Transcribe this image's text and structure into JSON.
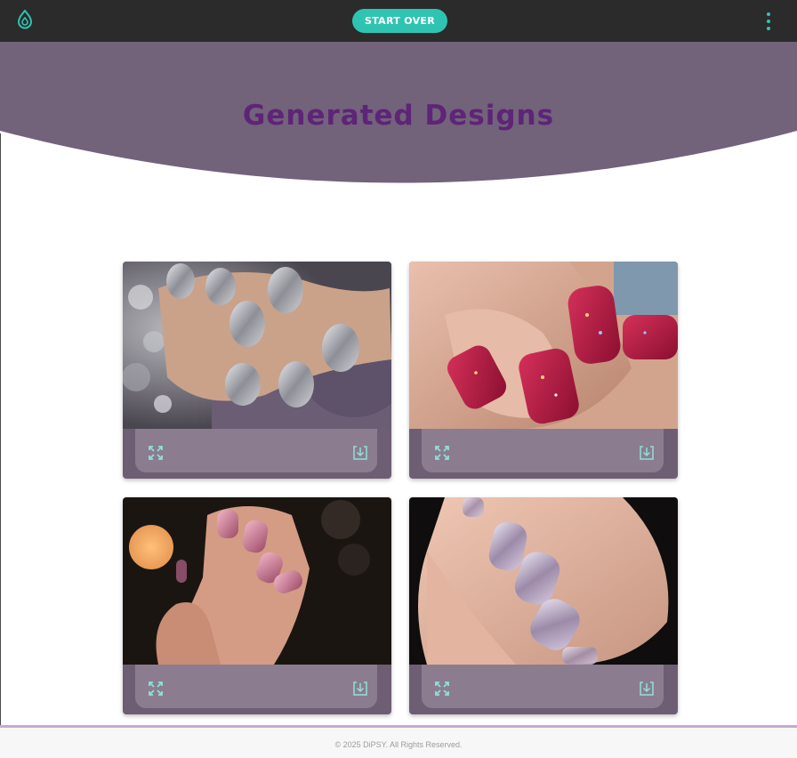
{
  "header": {
    "logo_icon": "droplet-icon",
    "start_over_label": "START OVER",
    "menu_icon": "kebab-menu-icon",
    "accent_color": "#2fc4b2"
  },
  "hero": {
    "title": "Generated Designs",
    "background_color": "#72627a",
    "title_color": "#5e2478"
  },
  "designs": [
    {
      "description": "Silver glitter nails",
      "expand_icon": "expand-icon",
      "download_icon": "download-icon"
    },
    {
      "description": "Red glitter nails",
      "expand_icon": "expand-icon",
      "download_icon": "download-icon"
    },
    {
      "description": "Pink metallic nails",
      "expand_icon": "expand-icon",
      "download_icon": "download-icon"
    },
    {
      "description": "Lavender chrome nails",
      "expand_icon": "expand-icon",
      "download_icon": "download-icon"
    }
  ],
  "footer": {
    "copyright": "© 2025 DiPSY. All Rights Reserved."
  }
}
